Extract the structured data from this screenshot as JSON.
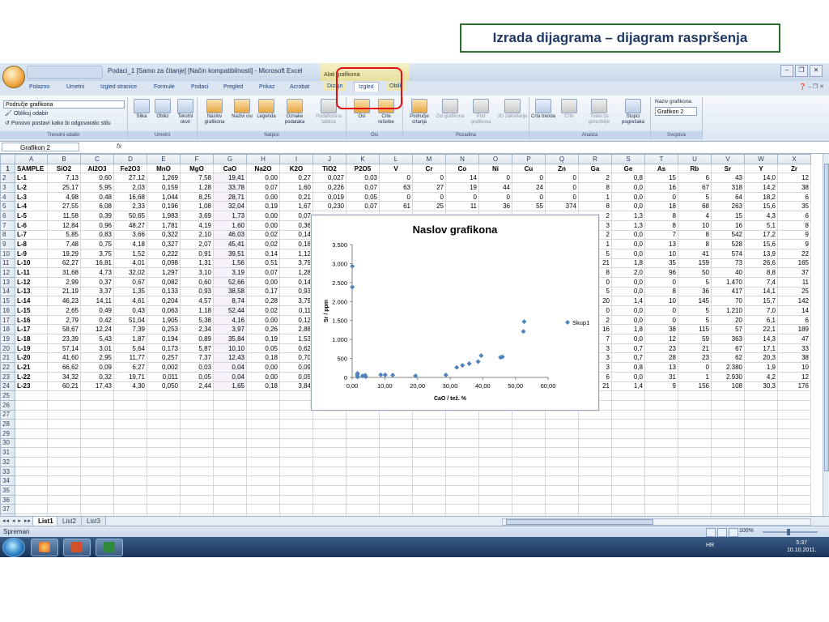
{
  "slide": {
    "title": "Izrada dijagrama – dijagram raspršenja"
  },
  "app": {
    "title": "Podaci_1 [Samo za čitanje] [Način kompatibilnosti] - Microsoft Excel",
    "context_tab_group": "Alati grafikona",
    "tabs": [
      "Polazno",
      "Umetni",
      "Izgled stranice",
      "Formule",
      "Podaci",
      "Pregled",
      "Prikaz",
      "Acrobat",
      "Dizajn",
      "Izgled",
      "Oblik"
    ],
    "active_tab": "Izgled"
  },
  "ribbon": {
    "selection_combo": "Područje grafikona",
    "format_selection": "Oblikuj odabir",
    "reset_style": "Ponovo postavi kako bi odgovaralo stilu",
    "group_current": "Trenutni odabir",
    "insert_buttons": [
      "Slika",
      "Oblici",
      "Tekstni okvir"
    ],
    "group_insert": "Umetni",
    "label_buttons": [
      "Naslov grafikona",
      "Nazivi osi",
      "Legenda",
      "Oznake podataka",
      "Podatkovna tablica"
    ],
    "group_labels": "Natpisi",
    "axes_buttons": [
      "Osi",
      "Crte rešetke"
    ],
    "group_axes": "Osi",
    "background_buttons": [
      "Područje crtanja",
      "Zid grafikona",
      "Pod grafikona",
      "3D zakretanje"
    ],
    "group_background": "Pozadina",
    "analysis_buttons": [
      "Crta trenda",
      "Crte",
      "Trake za gore/dolje",
      "Stupci pogrešaka"
    ],
    "group_analysis": "Analiza",
    "chart_name_label": "Naziv grafikona:",
    "chart_name_value": "Grafikon 2",
    "group_properties": "Svojstva"
  },
  "formula_bar": {
    "name_box": "Grafikon 2",
    "fx": "fx"
  },
  "sheet": {
    "col_letters": [
      "A",
      "B",
      "C",
      "D",
      "E",
      "F",
      "G",
      "H",
      "I",
      "J",
      "K",
      "L",
      "M",
      "N",
      "O",
      "P",
      "Q",
      "R",
      "S",
      "T",
      "U",
      "V",
      "W",
      "X"
    ],
    "headers": [
      "SAMPLE",
      "SiO2",
      "Al2O3",
      "Fe2O3",
      "MnO",
      "MgO",
      "CaO",
      "Na2O",
      "K2O",
      "TiO2",
      "P2O5",
      "V",
      "Cr",
      "Co",
      "Ni",
      "Cu",
      "Zn",
      "Ga",
      "Ge",
      "As",
      "Rb",
      "Sr",
      "Y",
      "Zr"
    ],
    "rows": [
      [
        "L-1",
        "7,13",
        "0,60",
        "27,12",
        "1,269",
        "7,58",
        "19,41",
        "0,00",
        "0,27",
        "0,027",
        "0,03",
        "0",
        "0",
        "14",
        "0",
        "0",
        "0",
        "2",
        "0,8",
        "15",
        "6",
        "43",
        "14,0",
        "12"
      ],
      [
        "L-2",
        "25,17",
        "5,95",
        "2,03",
        "0,159",
        "1,28",
        "33,78",
        "0,07",
        "1,60",
        "0,226",
        "0,07",
        "63",
        "27",
        "19",
        "44",
        "24",
        "0",
        "8",
        "0,0",
        "16",
        "67",
        "318",
        "14,2",
        "38"
      ],
      [
        "L-3",
        "4,98",
        "0,48",
        "16,68",
        "1,044",
        "8,25",
        "28,71",
        "0,00",
        "0,21",
        "0,019",
        "0,05",
        "0",
        "0",
        "0",
        "0",
        "0",
        "0",
        "1",
        "0,0",
        "0",
        "5",
        "64",
        "18,2",
        "6"
      ],
      [
        "L-4",
        "27,55",
        "6,08",
        "2,33",
        "0,196",
        "1,08",
        "32,04",
        "0,19",
        "1,67",
        "0,230",
        "0,07",
        "61",
        "25",
        "11",
        "36",
        "55",
        "374",
        "8",
        "0,0",
        "18",
        "68",
        "263",
        "15,6",
        "35"
      ],
      [
        "L-5",
        "11,58",
        "0,39",
        "50,65",
        "1,983",
        "3,69",
        "1,73",
        "0,00",
        "0,07",
        "",
        "",
        "",
        "",
        "",
        "",
        "",
        "",
        "2",
        "1,3",
        "8",
        "4",
        "15",
        "4,3",
        "6"
      ],
      [
        "L-6",
        "12,84",
        "0,96",
        "48,27",
        "1,781",
        "4,19",
        "1,60",
        "0,00",
        "0,36",
        "",
        "",
        "",
        "",
        "",
        "",
        "",
        "",
        "3",
        "1,3",
        "8",
        "10",
        "16",
        "5,1",
        "8"
      ],
      [
        "L-7",
        "5,85",
        "0,83",
        "3,66",
        "0,322",
        "2,10",
        "46,03",
        "0,02",
        "0,14",
        "",
        "",
        "",
        "",
        "",
        "",
        "",
        "",
        "2",
        "0,0",
        "7",
        "8",
        "542",
        "17,2",
        "9"
      ],
      [
        "L-8",
        "7,48",
        "0,75",
        "4,18",
        "0,327",
        "2,07",
        "45,41",
        "0,02",
        "0,18",
        "",
        "",
        "",
        "",
        "",
        "",
        "",
        "",
        "1",
        "0,0",
        "13",
        "8",
        "528",
        "15,6",
        "9"
      ],
      [
        "L-9",
        "19,29",
        "3,75",
        "1,52",
        "0,222",
        "0,91",
        "39,51",
        "0,14",
        "1,12",
        "",
        "",
        "",
        "",
        "",
        "",
        "",
        "",
        "5",
        "0,0",
        "10",
        "41",
        "574",
        "13,9",
        "22"
      ],
      [
        "L-10",
        "62,27",
        "16,81",
        "4,01",
        "0,098",
        "1,31",
        "1,56",
        "0,51",
        "3,79",
        "",
        "",
        "",
        "",
        "",
        "",
        "",
        "",
        "21",
        "1,8",
        "35",
        "159",
        "73",
        "26,6",
        "165"
      ],
      [
        "L-11",
        "31,68",
        "4,73",
        "32,02",
        "1,297",
        "3,10",
        "3,19",
        "0,07",
        "1,28",
        "",
        "",
        "",
        "",
        "",
        "",
        "",
        "",
        "8",
        "2,0",
        "96",
        "50",
        "40",
        "8,8",
        "37"
      ],
      [
        "L-12",
        "2,99",
        "0,37",
        "0,67",
        "0,082",
        "0,60",
        "52,66",
        "0,00",
        "0,14",
        "",
        "",
        "",
        "",
        "",
        "",
        "",
        "",
        "0",
        "0,0",
        "0",
        "5",
        "1.470",
        "7,4",
        "11"
      ],
      [
        "L-13",
        "21,19",
        "3,37",
        "1,35",
        "0,133",
        "0,93",
        "38,58",
        "0,17",
        "0,93",
        "",
        "",
        "",
        "",
        "",
        "",
        "",
        "",
        "5",
        "0,0",
        "8",
        "36",
        "417",
        "14,1",
        "25"
      ],
      [
        "L-14",
        "46,23",
        "14,11",
        "4,61",
        "0,204",
        "4,57",
        "8,74",
        "0,28",
        "3,79",
        "",
        "",
        "",
        "",
        "",
        "",
        "",
        "",
        "20",
        "1,4",
        "10",
        "145",
        "70",
        "15,7",
        "142"
      ],
      [
        "L-15",
        "2,65",
        "0,49",
        "0,43",
        "0,063",
        "1,18",
        "52,44",
        "0,02",
        "0,11",
        "",
        "",
        "",
        "",
        "",
        "",
        "",
        "",
        "0",
        "0,0",
        "0",
        "5",
        "1.210",
        "7,0",
        "14"
      ],
      [
        "L-16",
        "2,79",
        "0,42",
        "51,04",
        "1,905",
        "5,38",
        "4,16",
        "0,00",
        "0,12",
        "",
        "",
        "",
        "",
        "",
        "",
        "",
        "",
        "2",
        "0,0",
        "0",
        "5",
        "20",
        "6,1",
        "6"
      ],
      [
        "L-17",
        "58,67",
        "12,24",
        "7,39",
        "0,253",
        "2,34",
        "3,97",
        "0,26",
        "2,88",
        "",
        "",
        "",
        "",
        "",
        "",
        "",
        "",
        "16",
        "1,8",
        "38",
        "115",
        "57",
        "22,1",
        "189"
      ],
      [
        "L-18",
        "23,39",
        "5,43",
        "1,87",
        "0,194",
        "0,89",
        "35,84",
        "0,19",
        "1,53",
        "",
        "",
        "",
        "",
        "",
        "",
        "",
        "",
        "7",
        "0,0",
        "12",
        "59",
        "363",
        "14,3",
        "47"
      ],
      [
        "L-19",
        "57,14",
        "3,01",
        "5,64",
        "0,173",
        "5,87",
        "10,10",
        "0,05",
        "0,62",
        "",
        "",
        "",
        "",
        "",
        "",
        "",
        "",
        "3",
        "0,7",
        "23",
        "21",
        "67",
        "17,1",
        "33"
      ],
      [
        "L-20",
        "41,60",
        "2,95",
        "11,77",
        "0,257",
        "7,37",
        "12,43",
        "0,18",
        "0,70",
        "",
        "",
        "",
        "",
        "",
        "",
        "",
        "",
        "3",
        "0,7",
        "28",
        "23",
        "62",
        "20,3",
        "38"
      ],
      [
        "L-21",
        "66,62",
        "0,09",
        "6,27",
        "0,002",
        "0,03",
        "0,04",
        "0,00",
        "0,09",
        "",
        "",
        "",
        "",
        "",
        "",
        "",
        "",
        "3",
        "0,8",
        "13",
        "0",
        "2.380",
        "1,9",
        "10"
      ],
      [
        "L-22",
        "34,32",
        "0,32",
        "19,71",
        "0,011",
        "0,05",
        "0,04",
        "0,00",
        "0,05",
        "",
        "",
        "",
        "",
        "",
        "",
        "",
        "",
        "6",
        "0,0",
        "31",
        "1",
        "2.930",
        "4,2",
        "12"
      ],
      [
        "L-23",
        "60,21",
        "17,43",
        "4,30",
        "0,050",
        "2,44",
        "1,65",
        "0,18",
        "3,84",
        "",
        "",
        "",
        "",
        "",
        "",
        "",
        "",
        "21",
        "1,4",
        "9",
        "156",
        "108",
        "30,3",
        "176"
      ]
    ],
    "empty_rows_from": 25,
    "empty_rows_to": 38
  },
  "sheet_tabs": [
    "List1",
    "List2",
    "List3"
  ],
  "status": {
    "mode": "Spreman",
    "zoom": "100%"
  },
  "taskbar": {
    "lang": "HR",
    "time": "5:37",
    "date": "10.10.2011."
  },
  "chart_data": {
    "type": "scatter",
    "title": "Naslov grafikona",
    "xlabel": "CaO / tež. %",
    "ylabel": "Sr / ppm",
    "xlim": [
      0,
      60
    ],
    "ylim": [
      0,
      3500
    ],
    "xticks": [
      "0,00",
      "10,00",
      "20,00",
      "30,00",
      "40,00",
      "50,00",
      "60,00"
    ],
    "yticks": [
      "0",
      "500",
      "1.000",
      "1.500",
      "2.000",
      "2.500",
      "3.000",
      "3.500"
    ],
    "series": [
      {
        "name": "Skup1",
        "color": "#4f81bd",
        "points": [
          [
            19.41,
            43
          ],
          [
            33.78,
            318
          ],
          [
            28.71,
            64
          ],
          [
            32.04,
            263
          ],
          [
            1.73,
            15
          ],
          [
            1.6,
            16
          ],
          [
            46.03,
            542
          ],
          [
            45.41,
            528
          ],
          [
            39.51,
            574
          ],
          [
            1.56,
            73
          ],
          [
            3.19,
            40
          ],
          [
            52.66,
            1470
          ],
          [
            38.58,
            417
          ],
          [
            8.74,
            70
          ],
          [
            52.44,
            1210
          ],
          [
            4.16,
            20
          ],
          [
            3.97,
            57
          ],
          [
            35.84,
            363
          ],
          [
            10.1,
            67
          ],
          [
            12.43,
            62
          ],
          [
            0.04,
            2380
          ],
          [
            0.04,
            2930
          ],
          [
            1.65,
            108
          ]
        ]
      }
    ],
    "legend": "right"
  }
}
